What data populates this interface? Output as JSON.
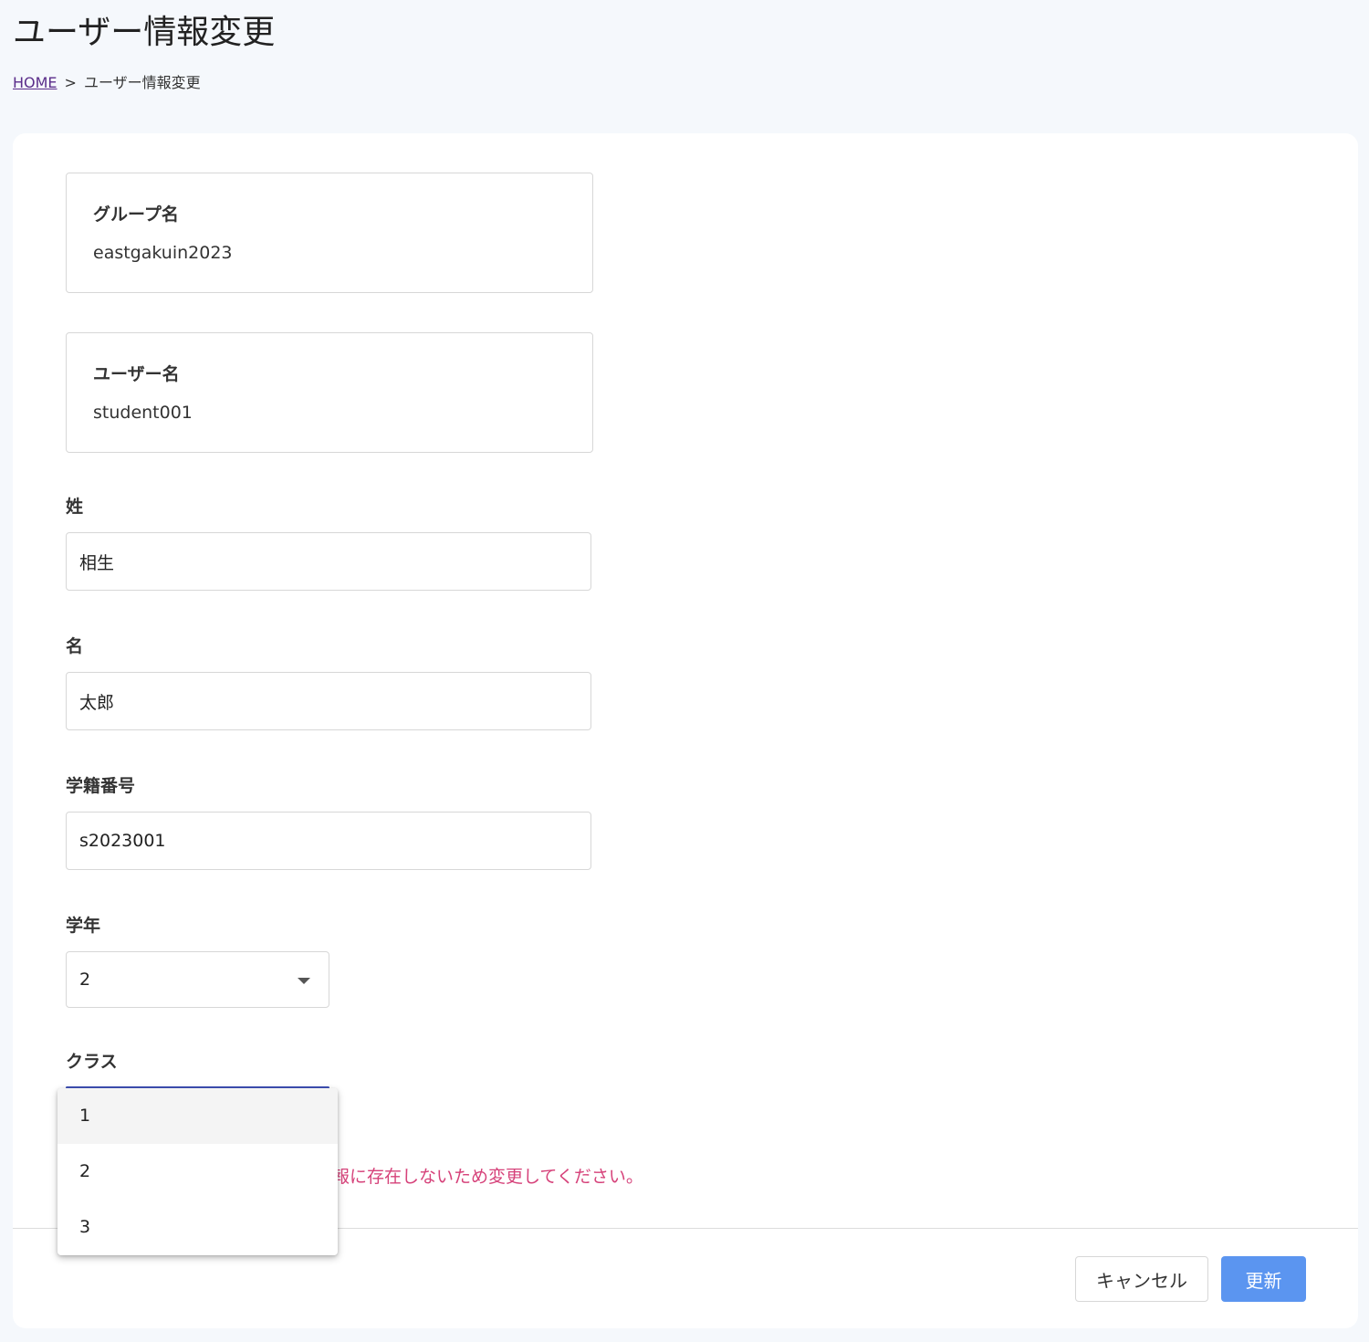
{
  "page": {
    "title": "ユーザー情報変更"
  },
  "breadcrumb": {
    "home": "HOME",
    "separator": ">",
    "current": "ユーザー情報変更"
  },
  "form": {
    "group": {
      "label": "グループ名",
      "value": "eastgakuin2023"
    },
    "username": {
      "label": "ユーザー名",
      "value": "student001"
    },
    "last_name": {
      "label": "姓",
      "value": "相生"
    },
    "first_name": {
      "label": "名",
      "value": "太郎"
    },
    "student_id": {
      "label": "学籍番号",
      "value": "s2023001"
    },
    "grade": {
      "label": "学年",
      "value": "2"
    },
    "class": {
      "label": "クラス",
      "options": [
        "1",
        "2",
        "3"
      ],
      "highlighted": "1"
    },
    "error_visible": "報に存在しないため変更してください。"
  },
  "actions": {
    "cancel": "キャンセル",
    "update": "更新"
  },
  "colors": {
    "accent": "#5b95f0",
    "error": "#d6427a",
    "focus": "#3f51b5"
  }
}
